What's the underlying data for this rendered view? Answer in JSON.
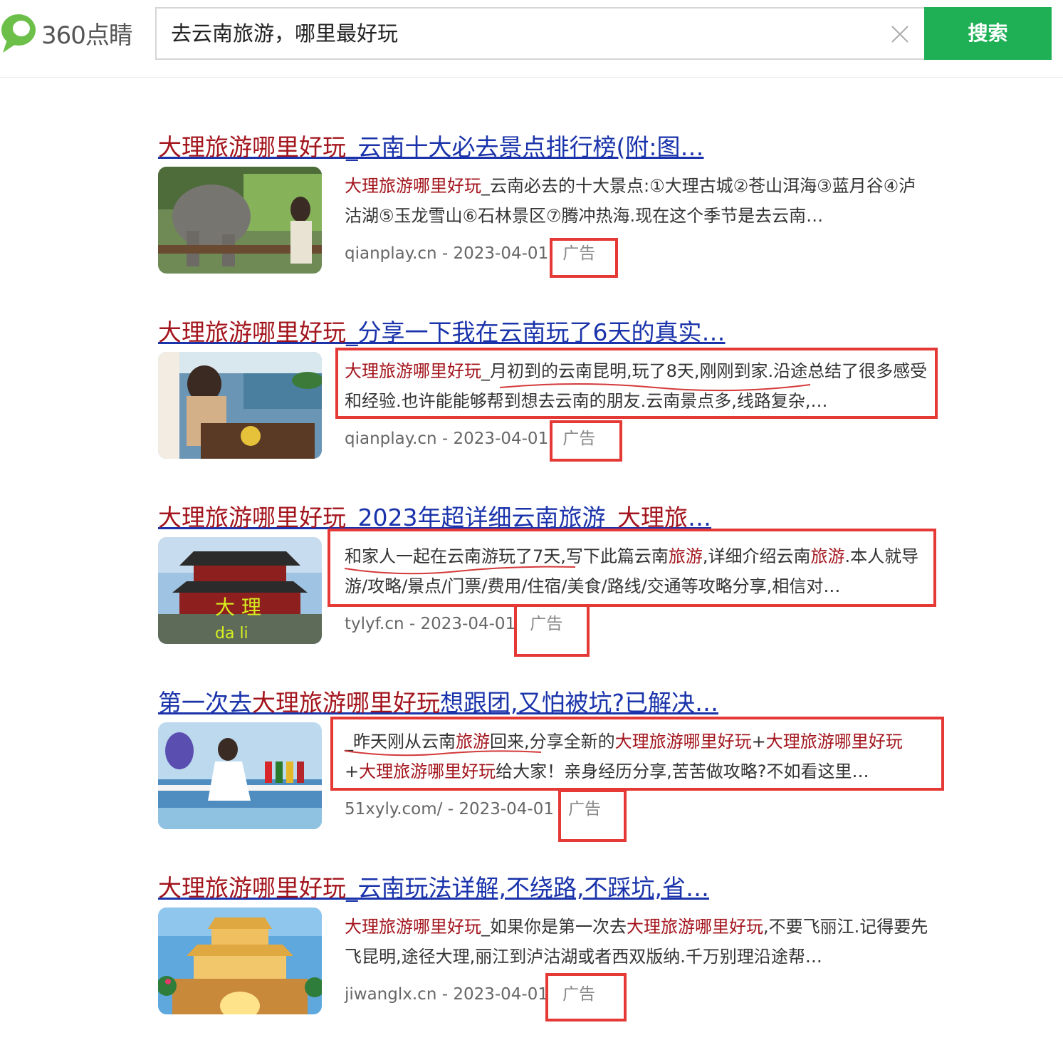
{
  "header": {
    "logo_text": "360点睛",
    "search_value": "去云南旅游，哪里最好玩",
    "search_button": "搜索",
    "brand_color": "#1fb056"
  },
  "results": [
    {
      "title_hl": "大理旅游哪里好玩",
      "title_rest": "_云南十大必去景点排行榜(附:图…",
      "snippet_hl": "大理旅游哪里好玩",
      "snippet_rest": "_云南必去的十大景点:①大理古城②苍山洱海③蓝月谷④泸沽湖⑤玉龙雪山⑥石林景区⑦腾冲热海.现在这个季节是去云南…",
      "site": "qianplay.cn - 2023-04-01",
      "ad": "广告"
    },
    {
      "title_hl": "大理旅游哪里好玩",
      "title_rest": "_分享一下我在云南玩了6天的真实…",
      "snippet_hl": "大理旅游哪里好玩",
      "snippet_rest": "_月初到的云南昆明,玩了8天,刚刚到家.沿途总结了很多感受和经验.也许能能够帮到想去云南的朋友.云南景点多,线路复杂,…",
      "site": "qianplay.cn - 2023-04-01",
      "ad": "广告"
    },
    {
      "title_hl": "大理旅游哪里好玩",
      "title_mid": "_2023年超详细云南旅游_",
      "title_hl2": "大理旅",
      "title_end": "…",
      "snippet_a": "和家人一起在云南游玩了7天,写下此篇云南",
      "snippet_hl1": "旅游",
      "snippet_b": ",详细介绍云南",
      "snippet_hl2": "旅游",
      "snippet_c": ".本人就导游/攻略/景点/门票/费用/住宿/美食/路线/交通等攻略分享,相信对…",
      "site": "tylyf.cn - 2023-04-01",
      "ad": "广告",
      "thumb_text1": "大 理",
      "thumb_text2": "da li"
    },
    {
      "title_pre": "第一次去",
      "title_hl": "大理旅游哪里好玩",
      "title_rest": "想跟团,又怕被坑?已解决…",
      "snippet_a": "_昨天刚从云南",
      "snippet_hl1": "旅游",
      "snippet_b": "回来,分享全新的",
      "snippet_hl2": "大理旅游哪里好玩",
      "snippet_c": "+",
      "snippet_hl3": "大理旅游哪里好玩",
      "snippet_d": "+",
      "snippet_hl4": "大理旅游哪里好玩",
      "snippet_e": "给大家！亲身经历分享,苦苦做攻略?不如看这里…",
      "site": "51xyly.com/ - 2023-04-01",
      "ad": "广告"
    },
    {
      "title_hl": "大理旅游哪里好玩",
      "title_rest": "_云南玩法详解,不绕路,不踩坑,省…",
      "snippet_hl1": "大理旅游哪里好玩",
      "snippet_a": "_如果你是第一次去",
      "snippet_hl2": "大理旅游哪里好玩",
      "snippet_b": ",不要飞丽江.记得要先飞昆明,途径大理,丽江到泸沽湖或者西双版纳.千万别理沿途帮…",
      "site": "jiwanglx.cn - 2023-04-01",
      "ad": "广告"
    }
  ]
}
